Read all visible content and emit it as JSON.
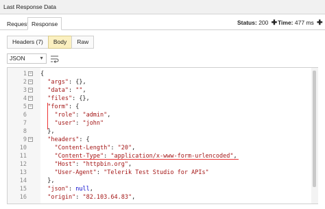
{
  "window": {
    "title": "Last Response Data"
  },
  "tabs": {
    "request": "Request",
    "response": "Response"
  },
  "stats": {
    "status_label": "Status:",
    "status_value": "200",
    "time_label": "Time:",
    "time_value": "477 ms"
  },
  "subtabs": {
    "headers": "Headers (7)",
    "body": "Body",
    "raw": "Raw"
  },
  "format": {
    "selected": "JSON"
  },
  "editor": {
    "lines": [
      {
        "n": "1",
        "fold": "−",
        "text": "{"
      },
      {
        "n": "2",
        "fold": "⊟",
        "text": "  \"args\": {},"
      },
      {
        "n": "3",
        "fold": "⊟",
        "text": "  \"data\": \"\","
      },
      {
        "n": "4",
        "fold": "⊟",
        "text": "  \"files\": {},"
      },
      {
        "n": "5",
        "fold": "⊟",
        "text": "  \"form\": {"
      },
      {
        "n": "6",
        "fold": "",
        "text": "    \"role\": \"admin\","
      },
      {
        "n": "7",
        "fold": "",
        "text": "    \"user\": \"john\""
      },
      {
        "n": "8",
        "fold": "",
        "text": "  },"
      },
      {
        "n": "9",
        "fold": "⊟",
        "text": "  \"headers\": {"
      },
      {
        "n": "10",
        "fold": "",
        "text": "    \"Content-Length\": \"20\","
      },
      {
        "n": "11",
        "fold": "",
        "text": "    \"Content-Type\": \"application/x-www-form-urlencoded\","
      },
      {
        "n": "12",
        "fold": "",
        "text": "    \"Host\": \"httpbin.org\","
      },
      {
        "n": "13",
        "fold": "",
        "text": "    \"User-Agent\": \"Telerik Test Studio for APIs\""
      },
      {
        "n": "14",
        "fold": "",
        "text": "  },"
      },
      {
        "n": "15",
        "fold": "",
        "text": "  \"json\": null,"
      },
      {
        "n": "16",
        "fold": "",
        "text": "  \"origin\": \"82.103.64.83\","
      }
    ]
  },
  "colors": {
    "accent_active_tab": "#fbf0c0",
    "highlight_mark": "#e33333",
    "string_color": "#a31515"
  },
  "icons": {
    "status_plus": "plus-icon",
    "time_plus": "plus-icon",
    "wrap": "word-wrap-icon",
    "dropdown": "chevron-down-icon"
  }
}
